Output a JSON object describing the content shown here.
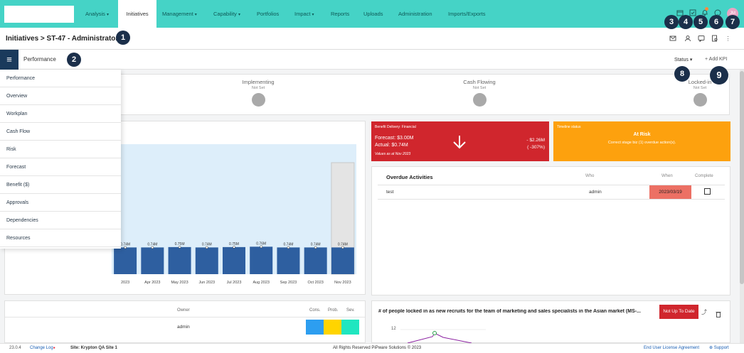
{
  "nav": {
    "items": [
      {
        "label": "Analysis",
        "caret": true
      },
      {
        "label": "Initiatives",
        "caret": false,
        "active": true
      },
      {
        "label": "Management",
        "caret": true
      },
      {
        "label": "Capability",
        "caret": true
      },
      {
        "label": "Portfolios",
        "caret": false
      },
      {
        "label": "Impact",
        "caret": true
      },
      {
        "label": "Reports",
        "caret": false
      },
      {
        "label": "Uploads",
        "caret": false
      },
      {
        "label": "Administration",
        "caret": false
      },
      {
        "label": "Imports/Exports",
        "caret": false
      }
    ],
    "avatar_initials": "JM",
    "top_icons": [
      "calendar-icon",
      "tasks-icon",
      "bell-icon",
      "help-icon",
      "settings-icon"
    ]
  },
  "markers": [
    "1",
    "2",
    "3",
    "4",
    "5",
    "6",
    "7",
    "8",
    "9"
  ],
  "header": {
    "title": "Initiatives > ST-47 - Administrator",
    "icons": [
      "mail-icon",
      "users-icon",
      "comment-icon",
      "document-search-icon",
      "more-vertical-icon"
    ]
  },
  "subbar": {
    "section": "Performance",
    "status_label": "Status",
    "add_kpi_label": "+ Add KPI"
  },
  "sidebar": {
    "items": [
      "Performance",
      "Overview",
      "Workplan",
      "Cash Flow",
      "Risk",
      "Forecast",
      "Benefit ($)",
      "Approvals",
      "Dependencies",
      "Resources"
    ]
  },
  "stages": [
    {
      "name": "Implementing",
      "status": "Not Set"
    },
    {
      "name": "Cash Flowing",
      "status": "Not Set"
    },
    {
      "name": "Locked-in",
      "status": "Not Set"
    }
  ],
  "chart_data": {
    "type": "bar",
    "categories": [
      "2023",
      "Apr 2023",
      "May 2023",
      "Jun 2023",
      "Jul 2023",
      "Aug 2023",
      "Sep 2023",
      "Oct 2023",
      "Nov 2023"
    ],
    "data_labels": [
      "0.74M",
      "0.74M",
      "0.75M",
      "0.74M",
      "0.75M",
      "0.76M",
      "0.74M",
      "0.74M",
      "0.74M"
    ],
    "values": [
      0.74,
      0.74,
      0.75,
      0.74,
      0.75,
      0.76,
      0.74,
      0.74,
      0.74
    ],
    "bar_color": "#2e5fa0",
    "band_color": "#ddeefa",
    "forecast_bar_color": "#e4e4e4"
  },
  "benefit": {
    "title": "Benefit Delivery: Financial",
    "forecast": "Forecast: $3.00M",
    "actual": "Actual: $0.74M",
    "values_as_at": "Values as at Nov 2023",
    "delta": "- $2.26M",
    "delta_pct": "( -307%)",
    "color": "#d0262d"
  },
  "timeline": {
    "title": "Timeline status",
    "status": "At Risk",
    "message": "Correct stage biz (1) overdue action(s).",
    "color": "#fda10e"
  },
  "overdue": {
    "title": "Overdue Activities",
    "columns": {
      "who": "Who",
      "when": "When",
      "complete": "Complete"
    },
    "rows": [
      {
        "activity": "test",
        "who": "admin",
        "when": "2023/03/19",
        "complete": false
      }
    ],
    "when_highlight": "#ec7064"
  },
  "risk_table": {
    "columns": [
      "Owner",
      "Cons.",
      "Prob.",
      "Sev."
    ],
    "rows": [
      {
        "owner": "admin",
        "colors": [
          "#2d9ef0",
          "#ffd400",
          "#20e6c0"
        ]
      }
    ]
  },
  "kpi": {
    "title": "# of people locked in as new recruits for the team of marketing and sales specialists in the Asian market (MS-...",
    "badge": "Not Up To Date",
    "badge_color": "#d0262d",
    "y_tick": "12"
  },
  "footer": {
    "version": "23.0.4",
    "change_log": "Change Log",
    "site": "Site: Krypton QA Site 1",
    "rights": "All Rights Reserved PiPware Solutions © 2023",
    "eula": "End User License Agreement",
    "support": "Support"
  }
}
